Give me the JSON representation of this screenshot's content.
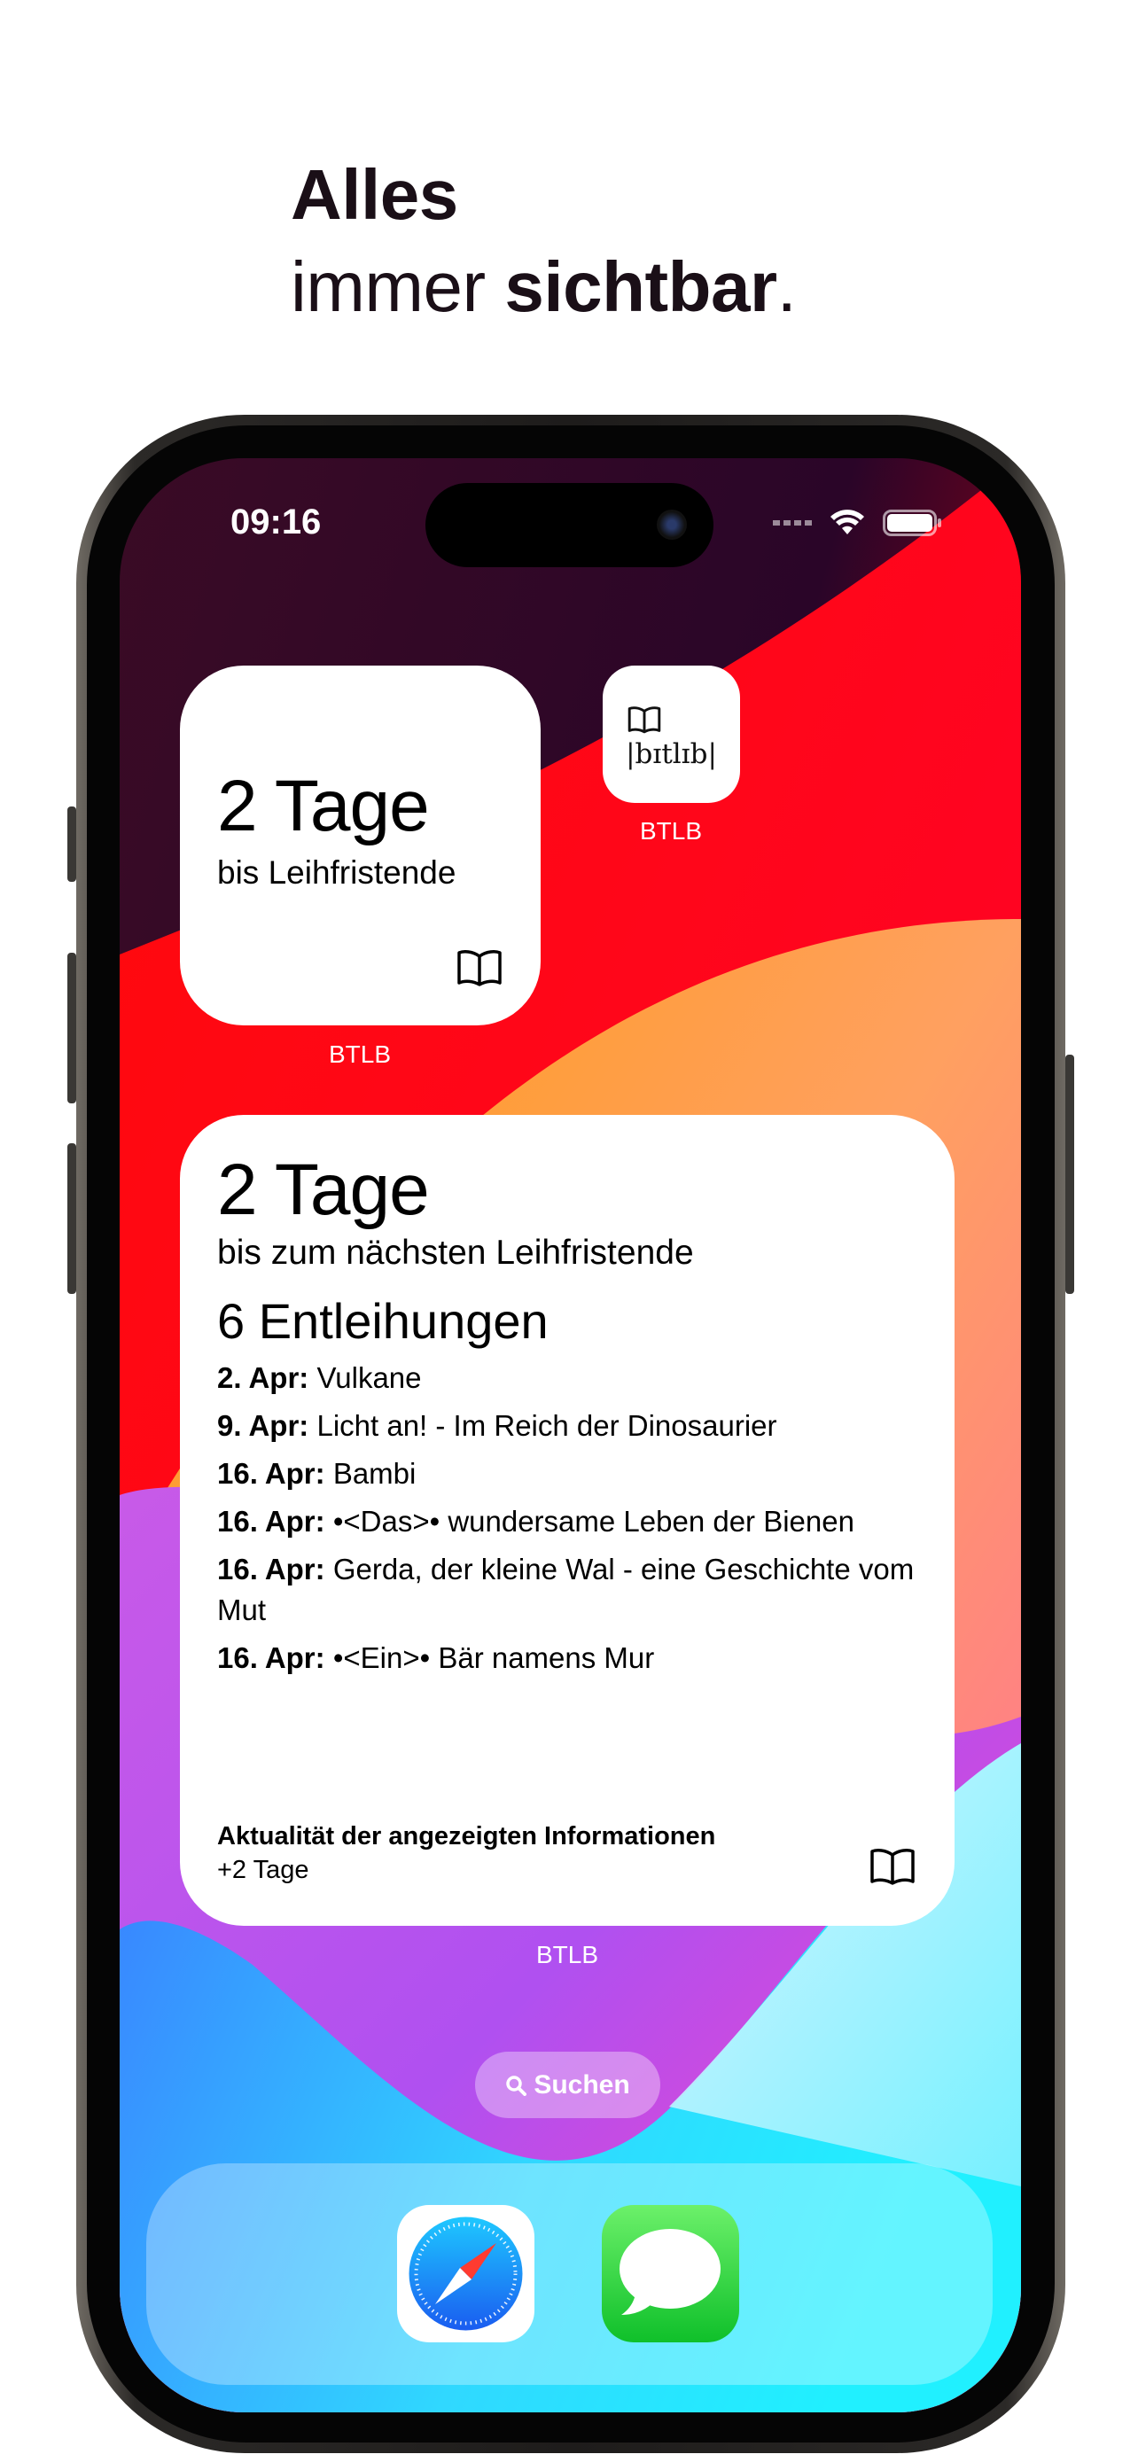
{
  "headline": {
    "line1_bold": "Alles",
    "line2_regular": "immer",
    "line2_bold": "sichtbar",
    "line2_end": "."
  },
  "status_bar": {
    "time": "09:16",
    "icons": [
      "cellular-icon",
      "wifi-icon",
      "battery-icon"
    ]
  },
  "small_widget": {
    "value": "2 Tage",
    "subtitle": "bis Leihfristende",
    "icon": "book-icon",
    "label": "BTLB"
  },
  "app_icon": {
    "logo_text": "|bɪtlɪb|",
    "label": "BTLB"
  },
  "large_widget": {
    "value": "2 Tage",
    "subtitle": "bis zum nächsten Leihfristende",
    "count": "6 Entleihungen",
    "loans": [
      {
        "date": "2. Apr:",
        "title": "Vulkane"
      },
      {
        "date": "9. Apr:",
        "title": "Licht an! - Im Reich der Dinosaurier"
      },
      {
        "date": "16. Apr:",
        "title": "Bambi"
      },
      {
        "date": "16. Apr:",
        "title": "•<Das>• wundersame Leben der Bienen"
      },
      {
        "date": "16. Apr:",
        "title": "Gerda, der kleine Wal - eine Geschichte vom Mut"
      },
      {
        "date": "16. Apr:",
        "title": "•<Ein>• Bär namens Mur"
      }
    ],
    "footer_title": "Aktualität der angezeigten Informationen",
    "footer_value": "+2 Tage",
    "icon": "book-icon",
    "label": "BTLB"
  },
  "search_button": {
    "label": "Suchen",
    "icon": "search-icon"
  },
  "dock": {
    "apps": [
      "Safari",
      "Messages"
    ]
  }
}
